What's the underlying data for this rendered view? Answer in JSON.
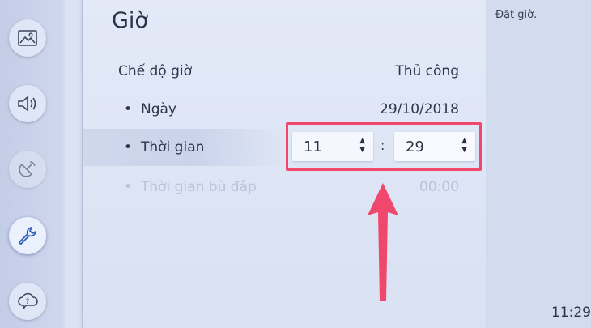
{
  "sidebar": {
    "items": [
      {
        "icon": "picture-icon"
      },
      {
        "icon": "sound-icon"
      },
      {
        "icon": "broadcast-icon"
      },
      {
        "icon": "wrench-icon"
      },
      {
        "icon": "help-cloud-icon"
      }
    ]
  },
  "panel": {
    "title": "Giờ",
    "clock_mode": {
      "label": "Chế độ giờ",
      "value": "Thủ công"
    },
    "date": {
      "bullet": "•",
      "label": "Ngày",
      "value": "29/10/2018"
    },
    "time": {
      "bullet": "•",
      "label": "Thời gian",
      "hour": "11",
      "minute": "29",
      "separator": ":"
    },
    "offset": {
      "bullet": "•",
      "label": "Thời gian bù đắp",
      "value": "00:00"
    }
  },
  "hint": "Đặt giờ.",
  "clock": "11:29",
  "colors": {
    "highlight": "#f0476c",
    "arrow": "#f0476c"
  }
}
